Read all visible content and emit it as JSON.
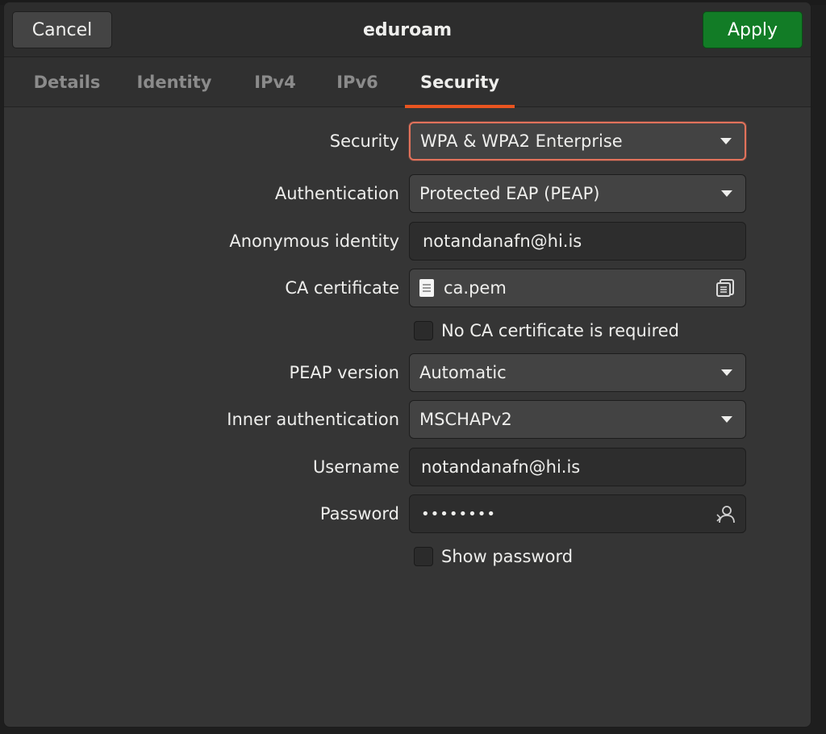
{
  "header": {
    "title": "eduroam",
    "cancel_label": "Cancel",
    "apply_label": "Apply"
  },
  "tabs": [
    {
      "label": "Details"
    },
    {
      "label": "Identity"
    },
    {
      "label": "IPv4"
    },
    {
      "label": "IPv6"
    },
    {
      "label": "Security",
      "active": true
    }
  ],
  "form": {
    "security": {
      "label": "Security",
      "value": "WPA & WPA2 Enterprise"
    },
    "authentication": {
      "label": "Authentication",
      "value": "Protected EAP (PEAP)"
    },
    "anonymous_identity": {
      "label": "Anonymous identity",
      "value": "notandanafn@hi.is"
    },
    "ca_certificate": {
      "label": "CA certificate",
      "value": "ca.pem"
    },
    "no_ca_required": {
      "label": "No CA certificate is required",
      "checked": false
    },
    "peap_version": {
      "label": "PEAP version",
      "value": "Automatic"
    },
    "inner_authentication": {
      "label": "Inner authentication",
      "value": "MSCHAPv2"
    },
    "username": {
      "label": "Username",
      "value": "notandanafn@hi.is"
    },
    "password": {
      "label": "Password",
      "value": "••••••••"
    },
    "show_password": {
      "label": "Show password",
      "checked": false
    }
  },
  "icons": {
    "ca_file": "document-icon",
    "ca_browse": "file-browse-icon",
    "password_user": "user-password-icon",
    "combo_arrow": "chevron-down-icon"
  },
  "colors": {
    "accent": "#e95420",
    "focus_ring": "#e2725b",
    "apply_button": "#127c26",
    "dialog_bg": "#353535"
  }
}
